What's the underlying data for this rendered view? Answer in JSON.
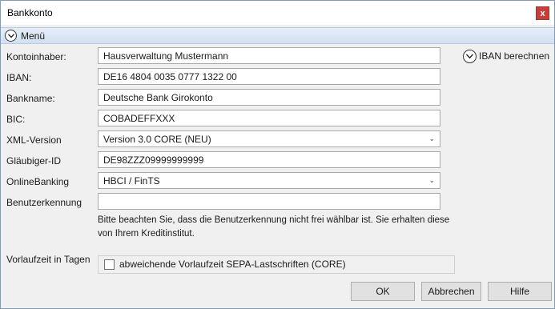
{
  "window": {
    "title": "Bankkonto",
    "close_label": "x"
  },
  "menu": {
    "label": "Menü"
  },
  "form": {
    "account_holder": {
      "label": "Kontoinhaber:",
      "value": "Hausverwaltung Mustermann"
    },
    "iban": {
      "label": "IBAN:",
      "value": "DE16 4804 0035 0777 1322 00"
    },
    "bank_name": {
      "label": "Bankname:",
      "value": "Deutsche Bank Girokonto"
    },
    "bic": {
      "label": "BIC:",
      "value": "COBADEFFXXX"
    },
    "xml_version": {
      "label": "XML-Version",
      "value": "Version 3.0 CORE (NEU)"
    },
    "creditor_id": {
      "label": "Gläubiger-ID",
      "value": "DE98ZZZ09999999999"
    },
    "online_banking": {
      "label": "OnlineBanking",
      "value": "HBCI / FinTS"
    },
    "username": {
      "label": "Benutzerkennung",
      "value": ""
    },
    "note": "Bitte beachten Sie, dass die Benutzerkennung nicht frei wählbar ist. Sie erhalten diese von Ihrem Kreditinstitut.",
    "lead_time": {
      "label": "Vorlaufzeit in Tagen",
      "checkbox_label": "abweichende Vorlaufzeit SEPA-Lastschriften (CORE)",
      "checked": false
    }
  },
  "iban_calculate": {
    "label": "IBAN berechnen"
  },
  "buttons": {
    "ok": "OK",
    "cancel": "Abbrechen",
    "help": "Hilfe"
  }
}
